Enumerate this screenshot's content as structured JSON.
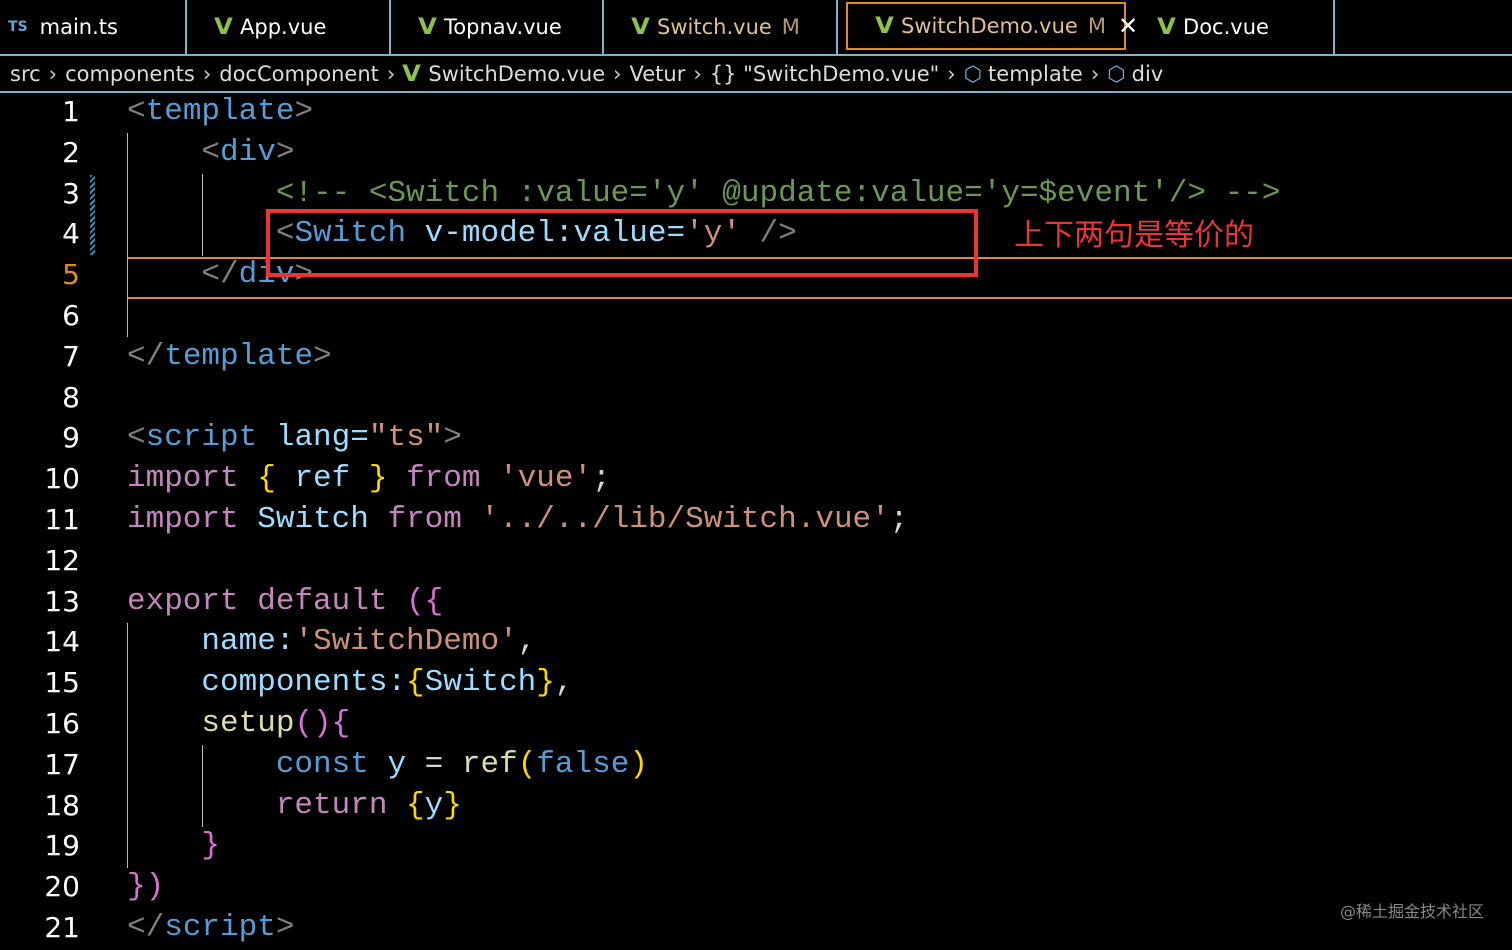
{
  "tabs": [
    {
      "label": "main.ts",
      "icon": "ts-icon",
      "icon_text": "TS",
      "modified": false,
      "active": false
    },
    {
      "label": "App.vue",
      "icon": "vue-icon",
      "modified": false,
      "active": false
    },
    {
      "label": "Topnav.vue",
      "icon": "vue-icon",
      "modified": false,
      "active": false
    },
    {
      "label": "Switch.vue",
      "icon": "vue-icon",
      "modified": true,
      "badge": "M",
      "active": false
    },
    {
      "label": "SwitchDemo.vue",
      "icon": "vue-icon",
      "modified": true,
      "badge": "M",
      "active": true,
      "close": "✕"
    },
    {
      "label": "Doc.vue",
      "icon": "vue-icon",
      "modified": false,
      "active": false
    }
  ],
  "breadcrumb": [
    "src",
    "components",
    "docComponent",
    "SwitchDemo.vue",
    "Vetur",
    "{} \"SwitchDemo.vue\"",
    "template",
    "div"
  ],
  "code": [
    [
      [
        "<",
        "br"
      ],
      [
        "template",
        "tag"
      ],
      [
        ">",
        "br"
      ]
    ],
    [
      [
        "    ",
        "w"
      ],
      [
        "<",
        "br"
      ],
      [
        "div",
        "tag"
      ],
      [
        ">",
        "br"
      ]
    ],
    [
      [
        "        <!-- <Switch :value='y' @update:value='y=$event'/> -->",
        "cmt"
      ]
    ],
    [
      [
        "        ",
        "w"
      ],
      [
        "<",
        "br"
      ],
      [
        "Switch",
        "tag"
      ],
      [
        " v-model:value=",
        "attr"
      ],
      [
        "'y'",
        "str"
      ],
      [
        " />",
        "br"
      ]
    ],
    [
      [
        "    ",
        "w"
      ],
      [
        "</",
        "br"
      ],
      [
        "div",
        "tag"
      ],
      [
        ">",
        "br"
      ]
    ],
    [],
    [
      [
        "</",
        "br"
      ],
      [
        "template",
        "tag"
      ],
      [
        ">",
        "br"
      ]
    ],
    [],
    [
      [
        "<",
        "br"
      ],
      [
        "script",
        "tag"
      ],
      [
        " lang=",
        "attr"
      ],
      [
        "\"ts\"",
        "str"
      ],
      [
        ">",
        "br"
      ]
    ],
    [
      [
        "import ",
        "kw"
      ],
      [
        "{ ",
        "y"
      ],
      [
        "ref",
        "var"
      ],
      [
        " } ",
        "y"
      ],
      [
        "from ",
        "kw"
      ],
      [
        "'vue'",
        "str"
      ],
      [
        ";",
        "w"
      ]
    ],
    [
      [
        "import ",
        "kw"
      ],
      [
        "Switch ",
        "var"
      ],
      [
        "from ",
        "kw"
      ],
      [
        "'../../lib/Switch.vue'",
        "str"
      ],
      [
        ";",
        "w"
      ]
    ],
    [],
    [
      [
        "export ",
        "kw"
      ],
      [
        "default ",
        "kw"
      ],
      [
        "(",
        "p"
      ],
      [
        "{",
        "p"
      ]
    ],
    [
      [
        "    name:",
        "var"
      ],
      [
        "'SwitchDemo'",
        "str"
      ],
      [
        ",",
        "w"
      ]
    ],
    [
      [
        "    components:",
        "var"
      ],
      [
        "{",
        "y"
      ],
      [
        "Switch",
        "var"
      ],
      [
        "}",
        "y"
      ],
      [
        ",",
        "w"
      ]
    ],
    [
      [
        "    setup",
        "fn"
      ],
      [
        "()",
        "p"
      ],
      [
        "{",
        "p"
      ]
    ],
    [
      [
        "        const ",
        "bl"
      ],
      [
        "y",
        "var"
      ],
      [
        " = ",
        "w"
      ],
      [
        "ref",
        "fn"
      ],
      [
        "(",
        "y"
      ],
      [
        "false",
        "bl"
      ],
      [
        ")",
        "y"
      ]
    ],
    [
      [
        "        return ",
        "kw"
      ],
      [
        "{",
        "y"
      ],
      [
        "y",
        "var"
      ],
      [
        "}",
        "y"
      ]
    ],
    [
      [
        "    }",
        "p"
      ]
    ],
    [
      [
        "}",
        "p"
      ],
      [
        ")",
        "p"
      ]
    ],
    [
      [
        "</",
        "br"
      ],
      [
        "script",
        "tag"
      ],
      [
        ">",
        "br"
      ]
    ]
  ],
  "current_line": 5,
  "annotation": "上下两句是等价的",
  "watermark": "@稀土掘金技术社区"
}
